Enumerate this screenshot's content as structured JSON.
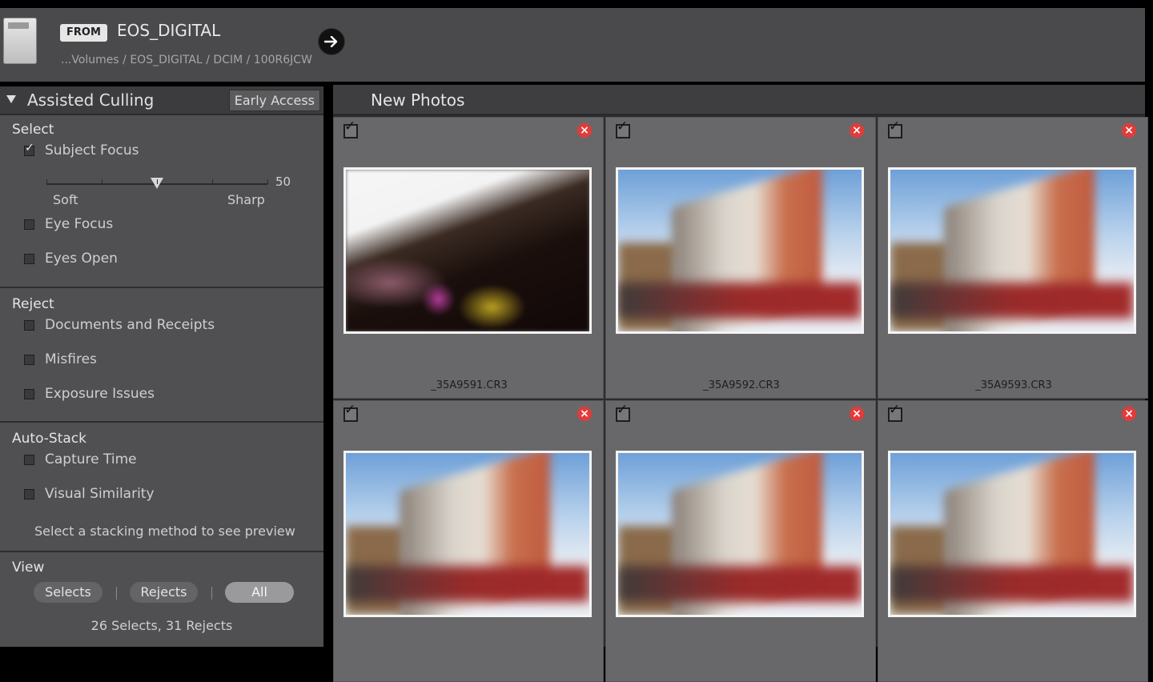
{
  "header": {
    "from_badge": "FROM",
    "source_name": "EOS_DIGITAL",
    "source_path": "...Volumes / EOS_DIGITAL / DCIM / 100R6JCW"
  },
  "panel": {
    "title": "Assisted Culling",
    "early_access": "Early Access",
    "select": {
      "title": "Select",
      "subject_focus": {
        "label": "Subject Focus",
        "checked": true
      },
      "slider": {
        "value": "50",
        "value_fraction": 0.5,
        "min_label": "Soft",
        "max_label": "Sharp"
      },
      "eye_focus": {
        "label": "Eye Focus",
        "checked": false
      },
      "eyes_open": {
        "label": "Eyes Open",
        "checked": false
      }
    },
    "reject": {
      "title": "Reject",
      "documents": {
        "label": "Documents and Receipts",
        "checked": false
      },
      "misfires": {
        "label": "Misfires",
        "checked": false
      },
      "exposure": {
        "label": "Exposure Issues",
        "checked": false
      }
    },
    "autostack": {
      "title": "Auto-Stack",
      "capture_time": {
        "label": "Capture Time",
        "checked": false
      },
      "visual_similarity": {
        "label": "Visual Similarity",
        "checked": false
      },
      "hint": "Select a stacking method to see preview"
    },
    "view": {
      "title": "View",
      "selects": "Selects",
      "rejects": "Rejects",
      "all": "All",
      "active": "All",
      "counts": "26 Selects, 31 Rejects"
    }
  },
  "grid": {
    "title": "New Photos",
    "photos": [
      {
        "filename": "_35A9591.CR3",
        "checked": true,
        "scene": "dark-street"
      },
      {
        "filename": "_35A9592.CR3",
        "checked": true,
        "scene": "building"
      },
      {
        "filename": "_35A9593.CR3",
        "checked": true,
        "scene": "building"
      },
      {
        "filename": "",
        "checked": true,
        "scene": "building"
      },
      {
        "filename": "",
        "checked": true,
        "scene": "building"
      },
      {
        "filename": "",
        "checked": true,
        "scene": "building"
      }
    ]
  },
  "colors": {
    "reject_icon": "#e33a3a",
    "panel_bg": "#505052",
    "cell_bg": "#68686a"
  },
  "icons": {
    "go": "arrow-right-icon",
    "reject": "close-icon",
    "collapse": "triangle-down-icon",
    "device": "memory-card-icon"
  }
}
